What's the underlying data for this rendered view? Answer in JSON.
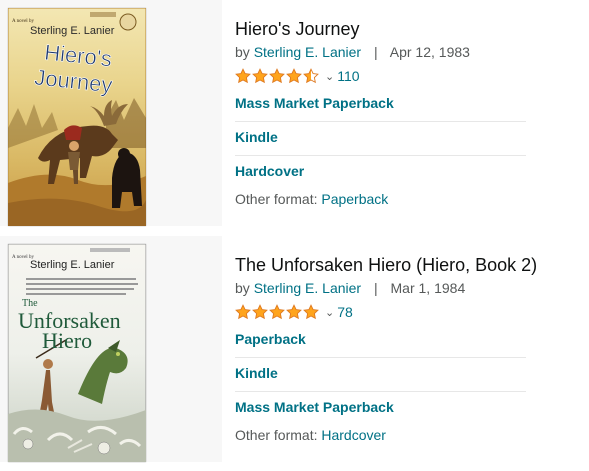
{
  "results": [
    {
      "cover": {
        "top_line": "A novel by",
        "author": "Sterling E. Lanier",
        "title_line1": "Hiero's",
        "title_line2": "Journey"
      },
      "title": "Hiero's Journey",
      "by": "by",
      "author": "Sterling E. Lanier",
      "sep": "|",
      "date": "Apr 12, 1983",
      "rating": 4.5,
      "review_count": "110",
      "formats": [
        "Mass Market Paperback",
        "Kindle",
        "Hardcover"
      ],
      "other_label": "Other format:",
      "other_value": "Paperback"
    },
    {
      "cover": {
        "top_line": "A novel by",
        "author": "Sterling E. Lanier",
        "title_line1": "The",
        "title_line2": "Unforsaken",
        "title_line3": "Hiero"
      },
      "title": "The Unforsaken Hiero (Hiero, Book 2)",
      "by": "by",
      "author": "Sterling E. Lanier",
      "sep": "|",
      "date": "Mar 1, 1984",
      "rating": 5,
      "review_count": "78",
      "formats": [
        "Paperback",
        "Kindle",
        "Mass Market Paperback"
      ],
      "other_label": "Other format:",
      "other_value": "Hardcover"
    }
  ],
  "colors": {
    "link": "#007185",
    "star": "#ffa41c",
    "star_outline": "#de7921",
    "muted": "#565959"
  },
  "icons": {
    "star": "star-icon",
    "chevron": "chevron-down-icon"
  }
}
